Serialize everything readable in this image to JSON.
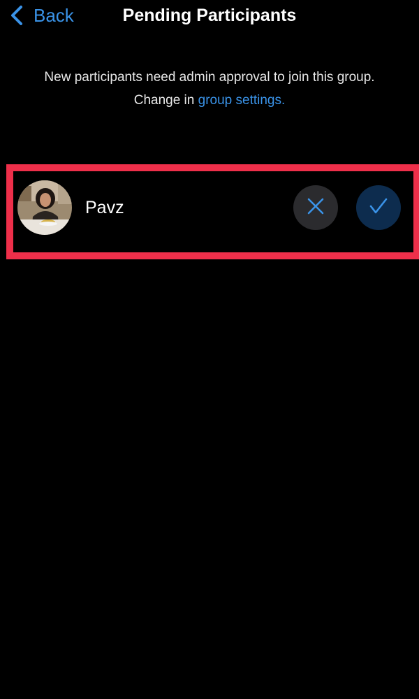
{
  "nav": {
    "back_label": "Back",
    "title": "Pending Participants"
  },
  "info": {
    "text": "New participants need admin approval to join this group. Change in",
    "link_text": "group settings."
  },
  "participants": [
    {
      "name": "Pavz",
      "reject_icon": "x-icon",
      "approve_icon": "checkmark-icon"
    }
  ],
  "colors": {
    "background": "#000000",
    "accent": "#3a93e8",
    "highlight": "#ee2f4a",
    "reject_button_bg": "#2b2b2e",
    "approve_button_bg": "#0d2c4e"
  }
}
